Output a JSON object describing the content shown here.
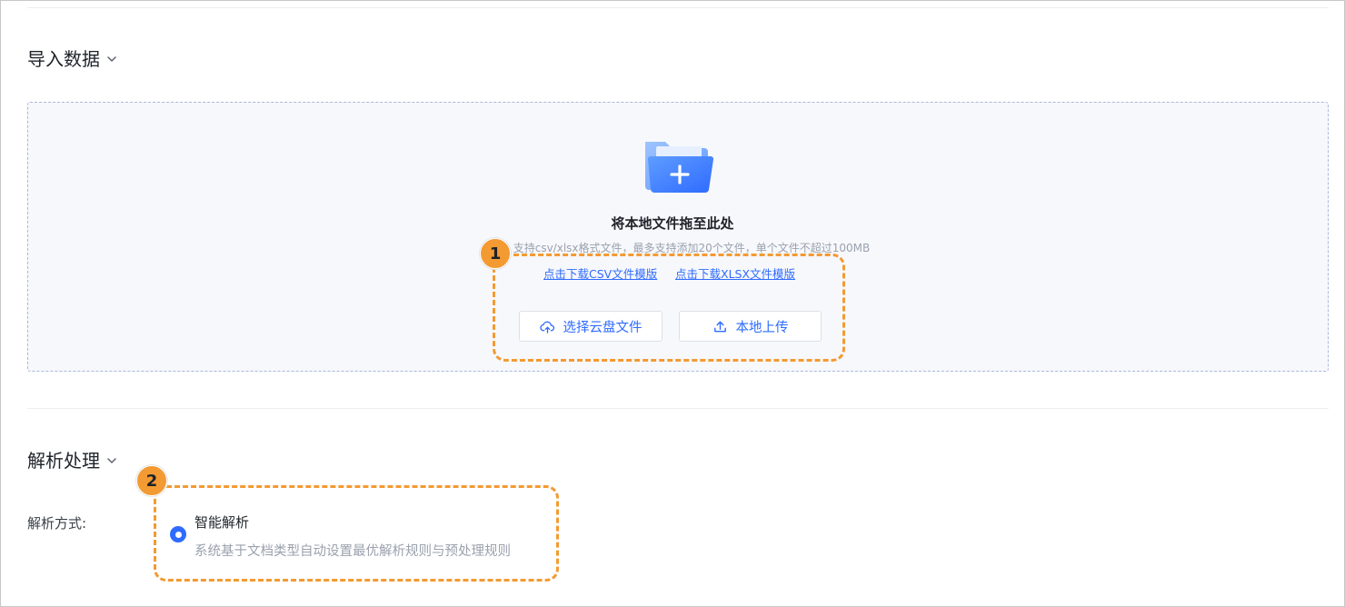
{
  "import_section": {
    "title": "导入数据",
    "dropzone": {
      "title": "将本地文件拖至此处",
      "hint": "支持csv/xlsx格式文件，最多支持添加20个文件，单个文件不超过100MB",
      "template_links": {
        "csv": "点击下载CSV文件模版",
        "xlsx": "点击下载XLSX文件模版"
      },
      "buttons": {
        "cloud": "选择云盘文件",
        "local": "本地上传"
      }
    }
  },
  "parse_section": {
    "title": "解析处理",
    "method_label": "解析方式:",
    "option": {
      "title": "智能解析",
      "description": "系统基于文档类型自动设置最优解析规则与预处理规则",
      "selected": true
    }
  },
  "callouts": {
    "one": "1",
    "two": "2"
  },
  "colors": {
    "accent": "#2f6bff",
    "callout": "#f39a33",
    "muted_text": "#9aa1ad"
  },
  "icons": {
    "chevron": "chevron-down-icon",
    "folder": "folder-add-icon",
    "cloud": "cloud-upload-icon",
    "upload": "upload-icon"
  }
}
